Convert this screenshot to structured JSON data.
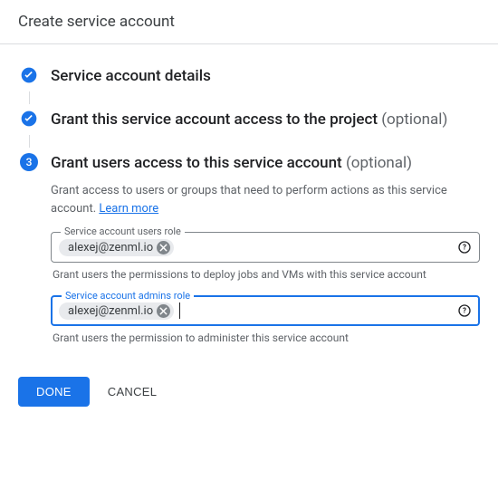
{
  "header": {
    "title": "Create service account"
  },
  "steps": {
    "s1": {
      "title": "Service account details"
    },
    "s2": {
      "title": "Grant this service account access to the project",
      "optional": "(optional)"
    },
    "s3": {
      "num": "3",
      "title": "Grant users access to this service account",
      "optional": "(optional)",
      "desc": "Grant access to users or groups that need to perform actions as this service account.",
      "learn": "Learn more"
    }
  },
  "fields": {
    "users": {
      "label": "Service account users role",
      "chip": "alexej@zenml.io",
      "helper": "Grant users the permissions to deploy jobs and VMs with this service account"
    },
    "admins": {
      "label": "Service account admins role",
      "chip": "alexej@zenml.io",
      "helper": "Grant users the permission to administer this service account"
    }
  },
  "actions": {
    "done": "DONE",
    "cancel": "CANCEL"
  }
}
